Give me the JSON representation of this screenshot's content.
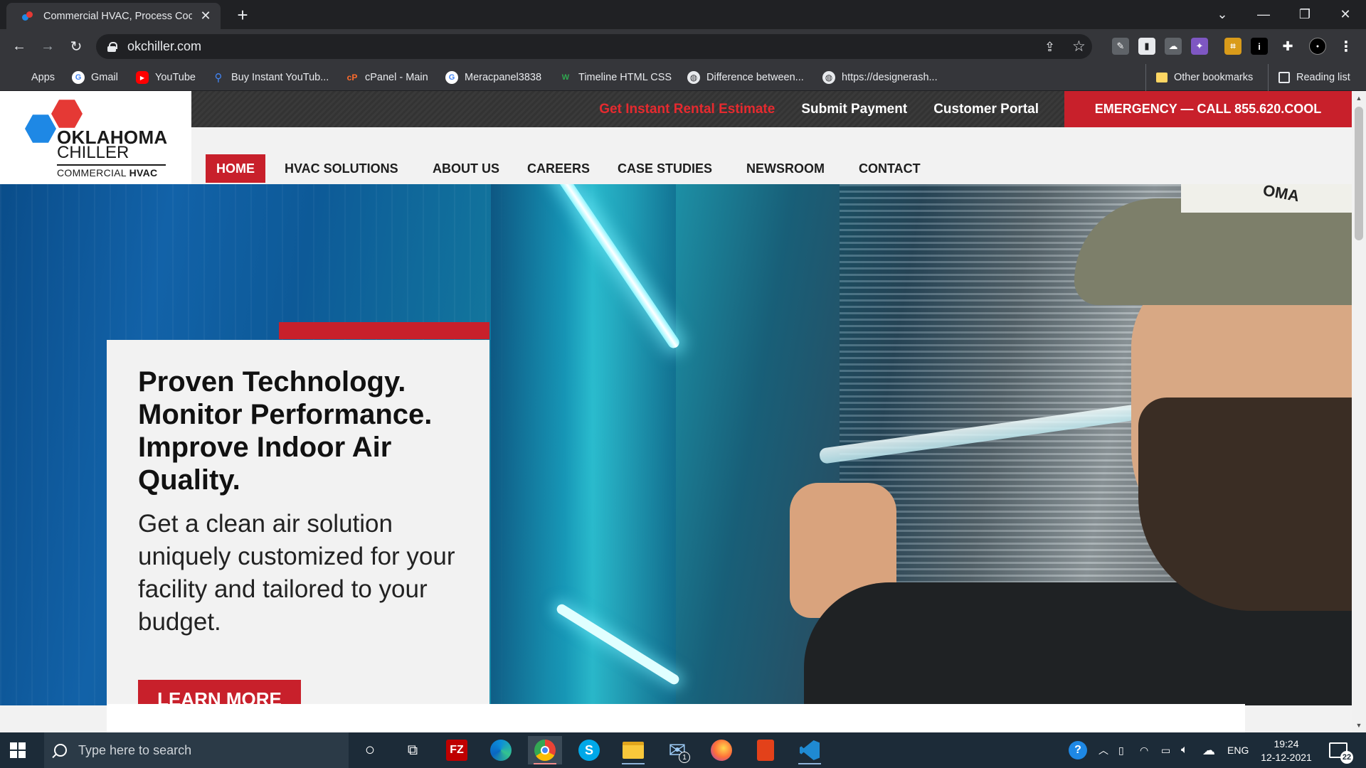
{
  "browser": {
    "tab_title": "Commercial HVAC, Process Cooli",
    "close_glyph": "✕",
    "new_tab_glyph": "+",
    "url": "okchiller.com",
    "window_controls": {
      "dropdown": "⌄",
      "minimize": "—",
      "restore": "❐",
      "close": "✕"
    },
    "nav": {
      "back": "←",
      "forward": "→",
      "reload": "↻"
    },
    "omnibox_icons": {
      "share": "⇪",
      "star": "☆"
    },
    "bookmarks": [
      {
        "label": "Apps",
        "icon": "apps-grid-icon"
      },
      {
        "label": "Gmail",
        "icon": "google-icon"
      },
      {
        "label": "YouTube",
        "icon": "youtube-icon"
      },
      {
        "label": "Buy Instant YouTub...",
        "icon": "search-icon"
      },
      {
        "label": "cPanel - Main",
        "icon": "cpanel-icon"
      },
      {
        "label": "Meracpanel3838",
        "icon": "google-icon"
      },
      {
        "label": "Timeline HTML CSS",
        "icon": "w-icon"
      },
      {
        "label": "Difference between...",
        "icon": "globe-icon"
      },
      {
        "label": "https://designerash...",
        "icon": "globe-icon"
      }
    ],
    "other_bookmarks": "Other bookmarks",
    "reading_list": "Reading list"
  },
  "site": {
    "logo": {
      "line1": "OKLAHOMA",
      "line2": "CHILLER",
      "line3a": "COMMERCIAL ",
      "line3b": "HVAC"
    },
    "utility": {
      "rental": "Get Instant Rental Estimate",
      "payment": "Submit Payment",
      "portal": "Customer Portal",
      "emergency": "EMERGENCY — CALL 855.620.COOL"
    },
    "nav": [
      "HOME",
      "HVAC SOLUTIONS",
      "ABOUT US",
      "CAREERS",
      "CASE STUDIES",
      "NEWSROOM",
      "CONTACT"
    ],
    "hero": {
      "title": "Proven Technology. Monitor Performance. Improve Indoor Air Quality.",
      "body": "Get a clean air solution uniquely customized for your facility and tailored to your budget.",
      "cta": "LEARN MORE",
      "cap_text": "OMA"
    },
    "scroll": {
      "up": "▲",
      "down": "▼"
    }
  },
  "taskbar": {
    "search_placeholder": "Type here to search",
    "apps": [
      {
        "name": "cortana",
        "glyph": "○"
      },
      {
        "name": "task-view",
        "glyph": "⧉"
      },
      {
        "name": "filezilla",
        "glyph": "FZ"
      },
      {
        "name": "edge",
        "glyph": ""
      },
      {
        "name": "chrome",
        "glyph": ""
      },
      {
        "name": "skype",
        "glyph": "S"
      },
      {
        "name": "file-explorer",
        "glyph": ""
      },
      {
        "name": "mail",
        "glyph": "✉"
      },
      {
        "name": "firefox",
        "glyph": ""
      },
      {
        "name": "office",
        "glyph": ""
      },
      {
        "name": "vscode",
        "glyph": ""
      }
    ],
    "mail_badge": "1",
    "language": "ENG",
    "time": "19:24",
    "date": "12-12-2021",
    "notification_count": "22"
  },
  "colors": {
    "brand_red": "#c8202b",
    "brand_blue": "#1e88e5",
    "chrome_dark": "#202124",
    "chrome_toolbar": "#35363a"
  }
}
